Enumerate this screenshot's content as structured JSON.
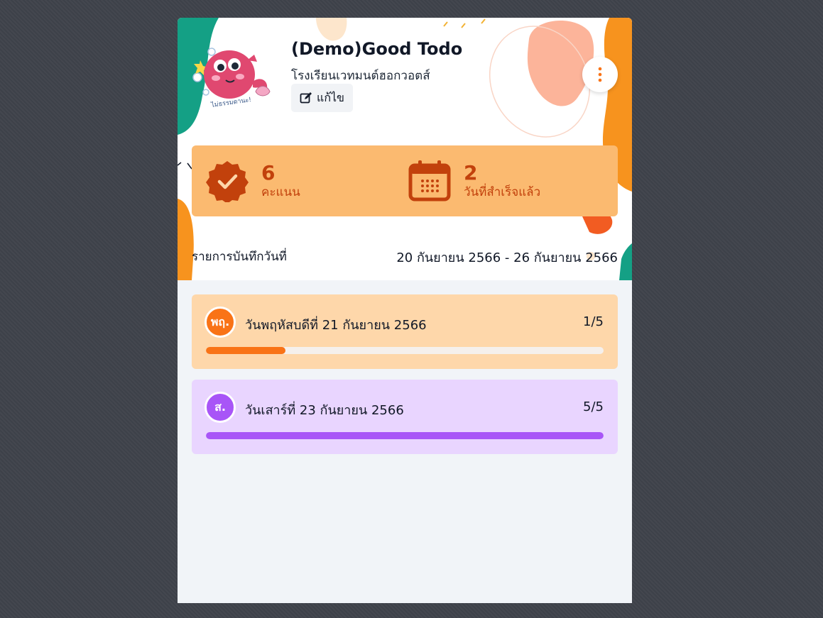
{
  "header": {
    "title": "(Demo)Good Todo",
    "school": "โรงเรียนเวทมนต์ฮอกวอตส์",
    "edit_label": "แก้ไข",
    "avatar_caption": "ไม่ธรรมดานะ!"
  },
  "stats": {
    "score": {
      "value": "6",
      "label": "คะแนน",
      "icon": "badge-check-icon"
    },
    "days": {
      "value": "2",
      "label": "วันที่สำเร็จแล้ว",
      "icon": "calendar-icon"
    }
  },
  "log": {
    "label": "รายการบันทึกวันที่",
    "range": "20 กันยายน 2566 - 26 กันยายน 2566"
  },
  "days": [
    {
      "badge": "พฤ.",
      "title": "วันพฤหัสบดีที่ 21 กันยายน 2566",
      "count": "1/5",
      "progress": 0.2,
      "color": "#f97316"
    },
    {
      "badge": "ส.",
      "title": "วันเสาร์ที่ 23 กันยายน 2566",
      "count": "5/5",
      "progress": 1.0,
      "color": "#a855f7"
    }
  ],
  "colors": {
    "accent": "#f97316",
    "stats_bg": "#fbba70",
    "stats_text": "#c2410c",
    "purple": "#a855f7",
    "teal": "#14a085"
  }
}
